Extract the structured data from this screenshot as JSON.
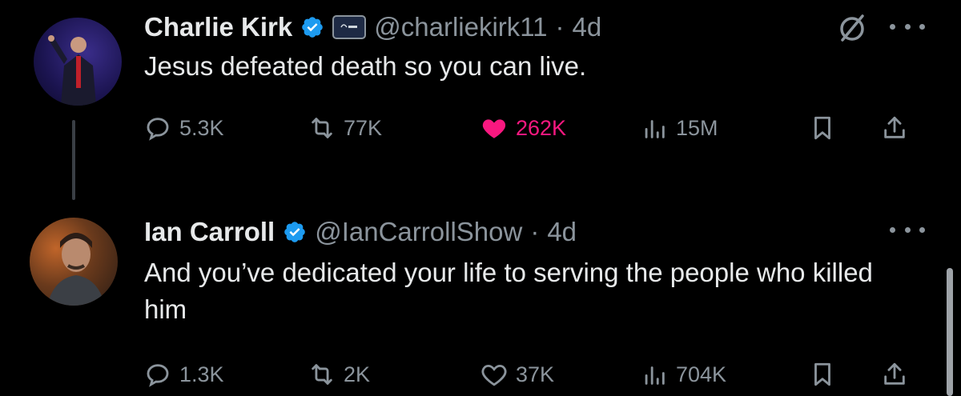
{
  "tweets": [
    {
      "author": "Charlie Kirk",
      "handle": "@charliekirk11",
      "separator": "·",
      "time": "4d",
      "text": "Jesus defeated death so you can live.",
      "replies": "5.3K",
      "reposts": "77K",
      "likes": "262K",
      "views": "15M",
      "liked": true
    },
    {
      "author": "Ian Carroll",
      "handle": "@IanCarrollShow",
      "separator": "·",
      "time": "4d",
      "text": "And you’ve dedicated your life to serving the people who killed him",
      "replies": "1.3K",
      "reposts": "2K",
      "likes": "37K",
      "views": "704K",
      "liked": false
    }
  ],
  "colors": {
    "background": "#000000",
    "text": "#e7e9ea",
    "muted": "#8b949c",
    "verified": "#1d9bf0",
    "like": "#f91880"
  },
  "icons": [
    "verified-badge-icon",
    "affiliate-badge-icon",
    "grok-icon",
    "more-icon",
    "reply-icon",
    "repost-icon",
    "like-icon",
    "views-icon",
    "bookmark-icon",
    "share-icon"
  ]
}
